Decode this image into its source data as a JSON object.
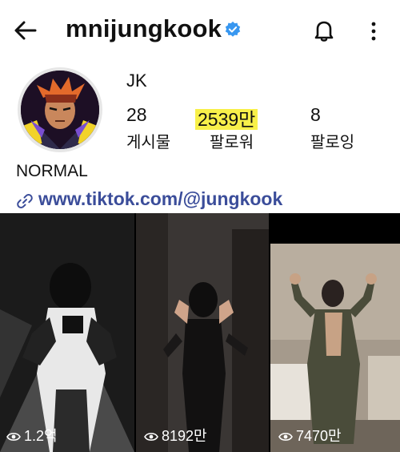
{
  "header": {
    "username": "mnijungkook"
  },
  "profile": {
    "display_name": "JK",
    "bio": "NORMAL",
    "link": "www.tiktok.com/@jungkook"
  },
  "stats": [
    {
      "value": "28",
      "label": "게시물"
    },
    {
      "value": "2539만",
      "label": "팔로워"
    },
    {
      "value": "8",
      "label": "팔로잉"
    }
  ],
  "posts": [
    {
      "views": "1.2억"
    },
    {
      "views": "8192만"
    },
    {
      "views": "7470만"
    }
  ],
  "colors": {
    "verified": "#3897f0",
    "link": "#3b4d9a",
    "highlight": "#f8f04a"
  }
}
